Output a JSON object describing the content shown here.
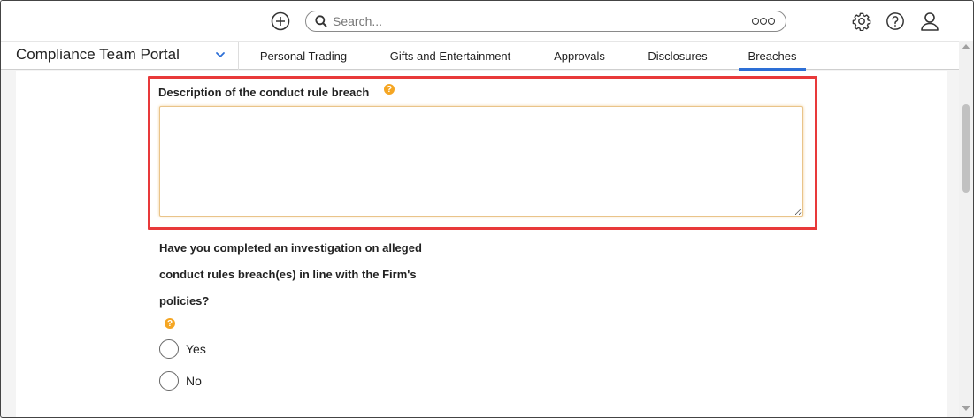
{
  "header": {
    "search_placeholder": "Search...",
    "icons": [
      "plus-circle-icon",
      "search-icon",
      "more-icon",
      "gear-icon",
      "help-icon",
      "user-icon"
    ]
  },
  "nav": {
    "portal_title": "Compliance Team Portal",
    "tabs": [
      {
        "label": "Personal Trading",
        "active": false
      },
      {
        "label": "Gifts and Entertainment",
        "active": false
      },
      {
        "label": "Approvals",
        "active": false
      },
      {
        "label": "Disclosures",
        "active": false
      },
      {
        "label": "Breaches",
        "active": true
      }
    ]
  },
  "form": {
    "description_label": "Description of the conduct rule breach",
    "description_value": "",
    "help_glyph": "?",
    "question_lines": [
      "Have you completed an investigation on alleged",
      "conduct rules breach(es) in line with the Firm's",
      "policies?"
    ],
    "options": [
      {
        "label": "Yes"
      },
      {
        "label": "No"
      }
    ]
  },
  "colors": {
    "accent": "#2d6fd6",
    "highlight": "#e8393a",
    "help": "#f5a623"
  }
}
